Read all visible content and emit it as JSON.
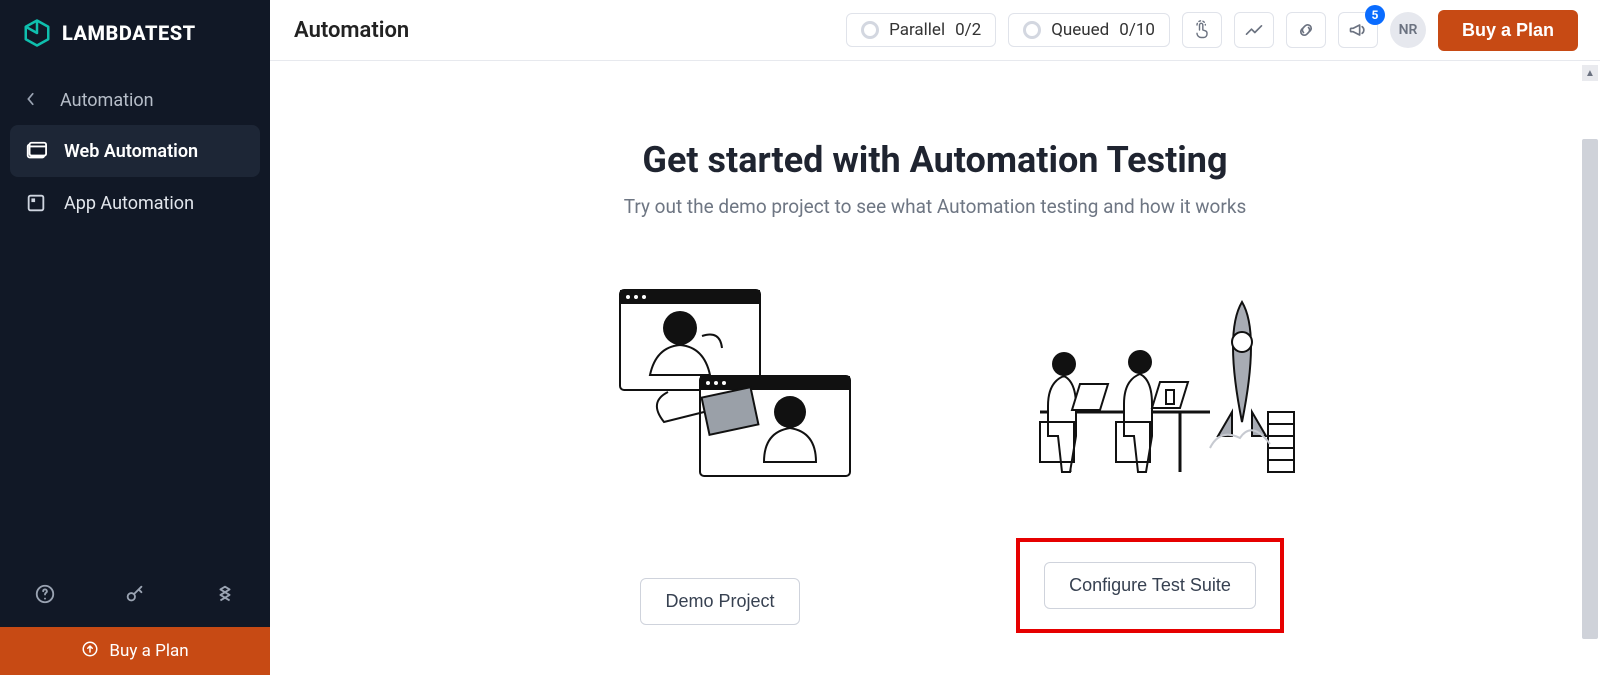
{
  "brand": {
    "name": "LAMBDATEST"
  },
  "sidebar": {
    "back_label": "Automation",
    "items": [
      {
        "label": "Web Automation"
      },
      {
        "label": "App Automation"
      }
    ],
    "buy_label": "Buy a Plan"
  },
  "topbar": {
    "title": "Automation",
    "parallel_label": "Parallel",
    "parallel_value": "0/2",
    "queued_label": "Queued",
    "queued_value": "0/10",
    "notification_count": "5",
    "avatar_initials": "NR",
    "buy_label": "Buy a Plan"
  },
  "main": {
    "heading": "Get started with Automation Testing",
    "subheading": "Try out the demo project to see what Automation testing and how it works",
    "card1_button": "Demo Project",
    "card2_button": "Configure Test Suite"
  }
}
